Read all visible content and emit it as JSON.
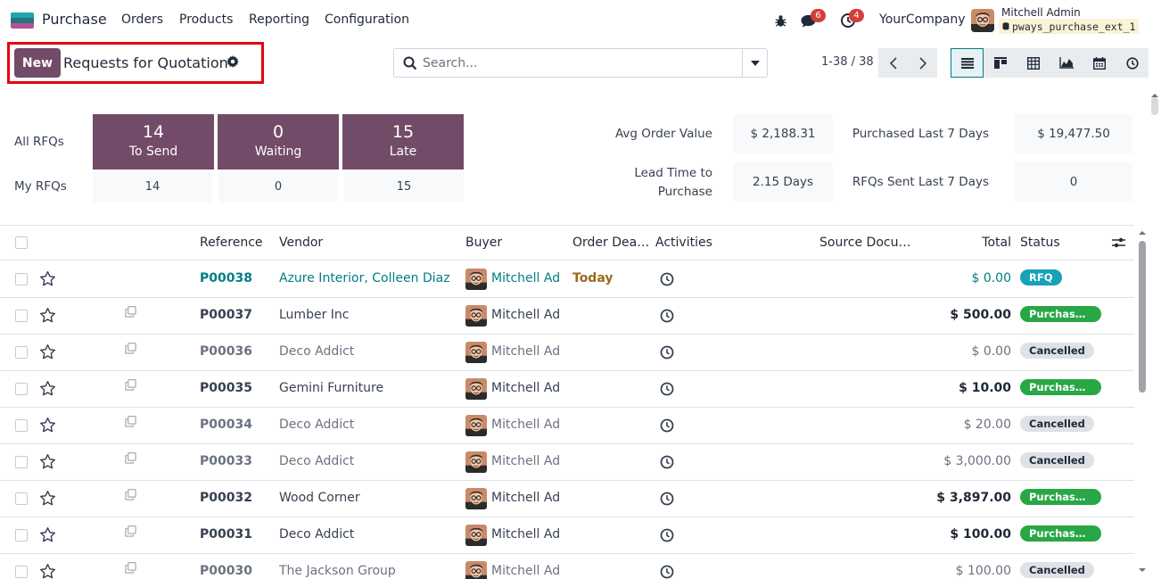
{
  "nav": {
    "app_name": "Purchase",
    "menus": [
      "Orders",
      "Products",
      "Reporting",
      "Configuration"
    ],
    "messages_count": "6",
    "activities_count": "4",
    "company": "YourCompany",
    "user_name": "Mitchell Admin",
    "db_name": "pways_purchase_ext_1"
  },
  "control": {
    "new_label": "New",
    "title": "Requests for Quotation",
    "search_placeholder": "Search...",
    "pager": "1-38 / 38",
    "views": [
      "list-view-icon",
      "kanban-view-icon",
      "pivot-view-icon",
      "graph-view-icon",
      "calendar-view-icon",
      "activity-view-icon"
    ]
  },
  "dashboard": {
    "all_label": "All RFQs",
    "my_label": "My RFQs",
    "tiles": [
      {
        "num": "14",
        "label": "To Send",
        "mine": "14"
      },
      {
        "num": "0",
        "label": "Waiting",
        "mine": "0"
      },
      {
        "num": "15",
        "label": "Late",
        "mine": "15"
      }
    ],
    "kpis": {
      "avg_order_label": "Avg Order Value",
      "avg_order_value": "$ 2,188.31",
      "purchased_label": "Purchased Last 7 Days",
      "purchased_value": "$ 19,477.50",
      "lead_time_label_1": "Lead Time to",
      "lead_time_label_2": "Purchase",
      "lead_time_value": "2.15 Days",
      "rfqs_sent_label": "RFQs Sent Last 7 Days",
      "rfqs_sent_value": "0"
    }
  },
  "list": {
    "headers": {
      "reference": "Reference",
      "vendor": "Vendor",
      "buyer": "Buyer",
      "order_deadline": "Order Dea…",
      "activities": "Activities",
      "source": "Source Docu…",
      "total": "Total",
      "status": "Status"
    },
    "rows": [
      {
        "ref": "P00038",
        "vendor": "Azure Interior, Colleen Diaz",
        "buyer": "Mitchell Admin",
        "deadline": "Today",
        "total": "$ 0.00",
        "status": "RFQ",
        "style": "link"
      },
      {
        "ref": "P00037",
        "vendor": "Lumber Inc",
        "buyer": "Mitchell Admin",
        "deadline": "",
        "total": "$ 500.00",
        "status": "Purchase Order",
        "style": "strong"
      },
      {
        "ref": "P00036",
        "vendor": "Deco Addict",
        "buyer": "Mitchell Admin",
        "deadline": "",
        "total": "$ 0.00",
        "status": "Cancelled",
        "style": "muted"
      },
      {
        "ref": "P00035",
        "vendor": "Gemini Furniture",
        "buyer": "Mitchell Admin",
        "deadline": "",
        "total": "$ 10.00",
        "status": "Purchase Order",
        "style": "strong"
      },
      {
        "ref": "P00034",
        "vendor": "Deco Addict",
        "buyer": "Mitchell Admin",
        "deadline": "",
        "total": "$ 20.00",
        "status": "Cancelled",
        "style": "muted"
      },
      {
        "ref": "P00033",
        "vendor": "Deco Addict",
        "buyer": "Mitchell Admin",
        "deadline": "",
        "total": "$ 3,000.00",
        "status": "Cancelled",
        "style": "muted"
      },
      {
        "ref": "P00032",
        "vendor": "Wood Corner",
        "buyer": "Mitchell Admin",
        "deadline": "",
        "total": "$ 3,897.00",
        "status": "Purchase Order",
        "style": "strong"
      },
      {
        "ref": "P00031",
        "vendor": "Deco Addict",
        "buyer": "Mitchell Admin",
        "deadline": "",
        "total": "$ 100.00",
        "status": "Purchase Order",
        "style": "strong"
      },
      {
        "ref": "P00030",
        "vendor": "The Jackson Group",
        "buyer": "Mitchell Admin",
        "deadline": "",
        "total": "$ 100.00",
        "status": "Cancelled",
        "style": "muted"
      }
    ]
  },
  "colors": {
    "brand": "#714b67",
    "accent": "#017e84",
    "rfq": "#17a2b8",
    "purchase": "#28a745",
    "cancelled": "#dee2e6",
    "highlight": "#e20613"
  }
}
